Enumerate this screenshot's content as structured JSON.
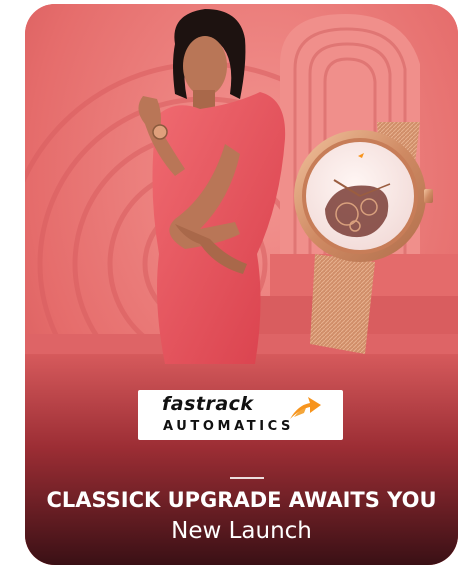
{
  "banner": {
    "brand_name": "fastrack",
    "brand_sub": "AUTOMATICS",
    "headline": "CLASSICK UPGRADE AWAITS YOU",
    "subheadline": "New Launch"
  },
  "colors": {
    "background": "#e8706f",
    "accent_orange": "#f7941d",
    "watch_gold": "#d99a72",
    "dress": "#e7545e"
  },
  "icons": {
    "brand_logo": "fastrack-arrow-logo",
    "watch": "rose-gold-mesh-watch"
  }
}
